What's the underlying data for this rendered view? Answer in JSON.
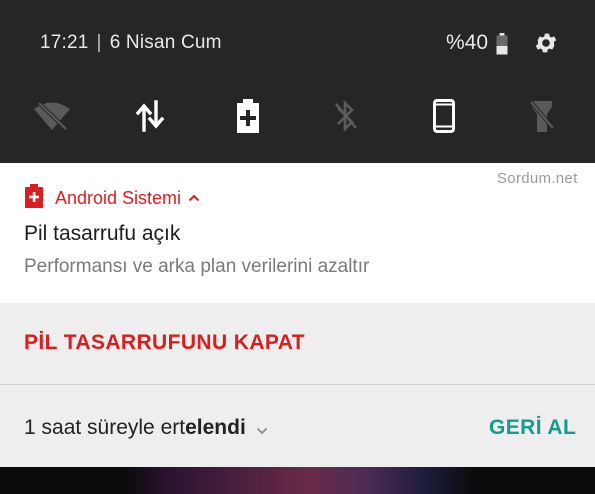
{
  "status_bar": {
    "time": "17:21",
    "separator": "|",
    "date": "6 Nisan Cum",
    "battery_percent": "%40",
    "icons": [
      "battery-icon",
      "gear-icon"
    ]
  },
  "quick_settings": {
    "tiles": [
      {
        "name": "wifi-off-icon",
        "state": "off"
      },
      {
        "name": "mobile-data-icon",
        "state": "on"
      },
      {
        "name": "battery-saver-icon",
        "state": "on"
      },
      {
        "name": "bluetooth-off-icon",
        "state": "off"
      },
      {
        "name": "phone-icon",
        "state": "on"
      },
      {
        "name": "flashlight-icon",
        "state": "off"
      }
    ]
  },
  "watermark": "Sordum.net",
  "notification": {
    "app_name": "Android Sistemi",
    "title": "Pil tasarrufu açık",
    "body": "Performansı ve arka plan verilerini azaltır",
    "action_label": "PİL TASARRUFUNU KAPAT",
    "accent_color": "#d81e1e"
  },
  "snooze": {
    "text_prefix": "1 saat süreyle ert",
    "text_bold": "elendi",
    "undo_label": "GERİ AL",
    "undo_color": "#169c8c"
  }
}
